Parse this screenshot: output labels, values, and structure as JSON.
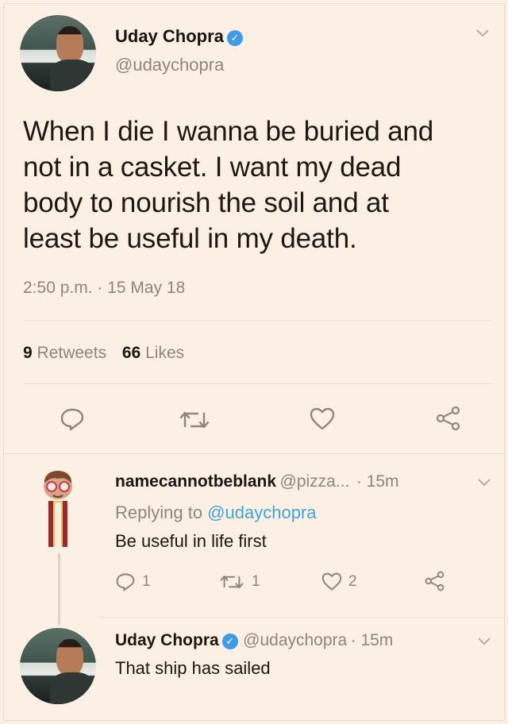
{
  "tweet": {
    "author_name": "Uday Chopra",
    "author_handle": "@udaychopra",
    "text_lines": [
      "When I die I wanna be buried and",
      "not in a casket. I want my dead",
      "body to nourish the soil and at",
      "least be useful in my death."
    ],
    "timestamp": "2:50 p.m. · 15 May 18",
    "retweets_count": "9",
    "retweets_label": "Retweets",
    "likes_count": "66",
    "likes_label": "Likes"
  },
  "reply1": {
    "name": "namecannotbeblank",
    "handle": "@pizza...",
    "time": "· 15m",
    "replying_prefix": "Replying to",
    "replying_handle": "@udaychopra",
    "text": "Be useful in life first",
    "reply_count": "1",
    "retweet_count": "1",
    "like_count": "2"
  },
  "reply2": {
    "name": "Uday Chopra",
    "handle": "@udaychopra",
    "time": "· 15m",
    "text": "That ship has sailed"
  },
  "colors": {
    "background": "#fcf0e4",
    "verified": "#3d9be9",
    "link": "#3ea4de",
    "muted": "#8e857c"
  },
  "icons": [
    "reply-icon",
    "retweet-icon",
    "like-icon",
    "share-icon",
    "verified-badge-icon",
    "chevron-down-icon"
  ]
}
